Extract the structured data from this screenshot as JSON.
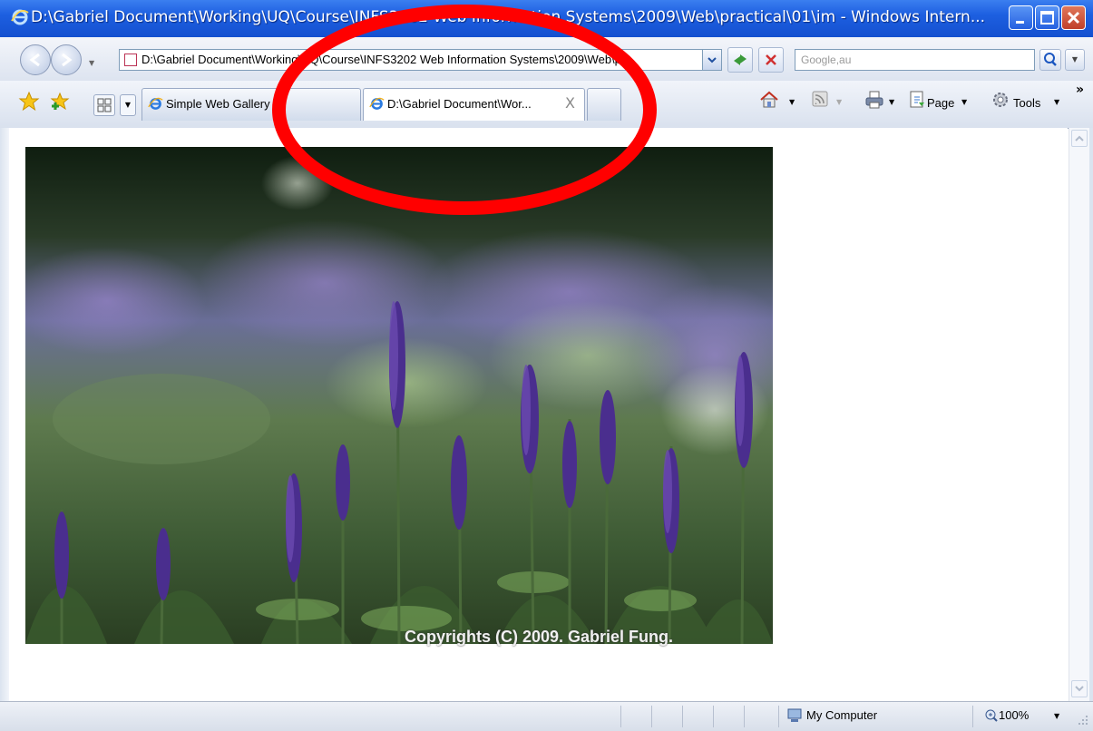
{
  "window": {
    "title": "D:\\Gabriel Document\\Working\\UQ\\Course\\INFS3202 Web Information Systems\\2009\\Web\\practical\\01\\im - Windows Intern..."
  },
  "nav": {
    "address": "D:\\Gabriel Document\\Working\\UQ\\Course\\INFS3202 Web Information Systems\\2009\\Web\\pr",
    "search_placeholder": "Google,au"
  },
  "tabs": [
    {
      "label": "Simple Web Gallery",
      "active": false
    },
    {
      "label": "D:\\Gabriel Document\\Wor...",
      "active": true,
      "close": "X"
    }
  ],
  "toolbar": {
    "page_label": "Page",
    "tools_label": "Tools",
    "overflow": "»"
  },
  "content": {
    "watermark": "Copyrights (C) 2009. Gabriel Fung."
  },
  "status": {
    "zone": "My Computer",
    "zoom": "100%"
  },
  "colors": {
    "titlebar": "#1d5fe0",
    "highlight_circle": "#ff0000",
    "lavender": "#5a3a9a"
  }
}
